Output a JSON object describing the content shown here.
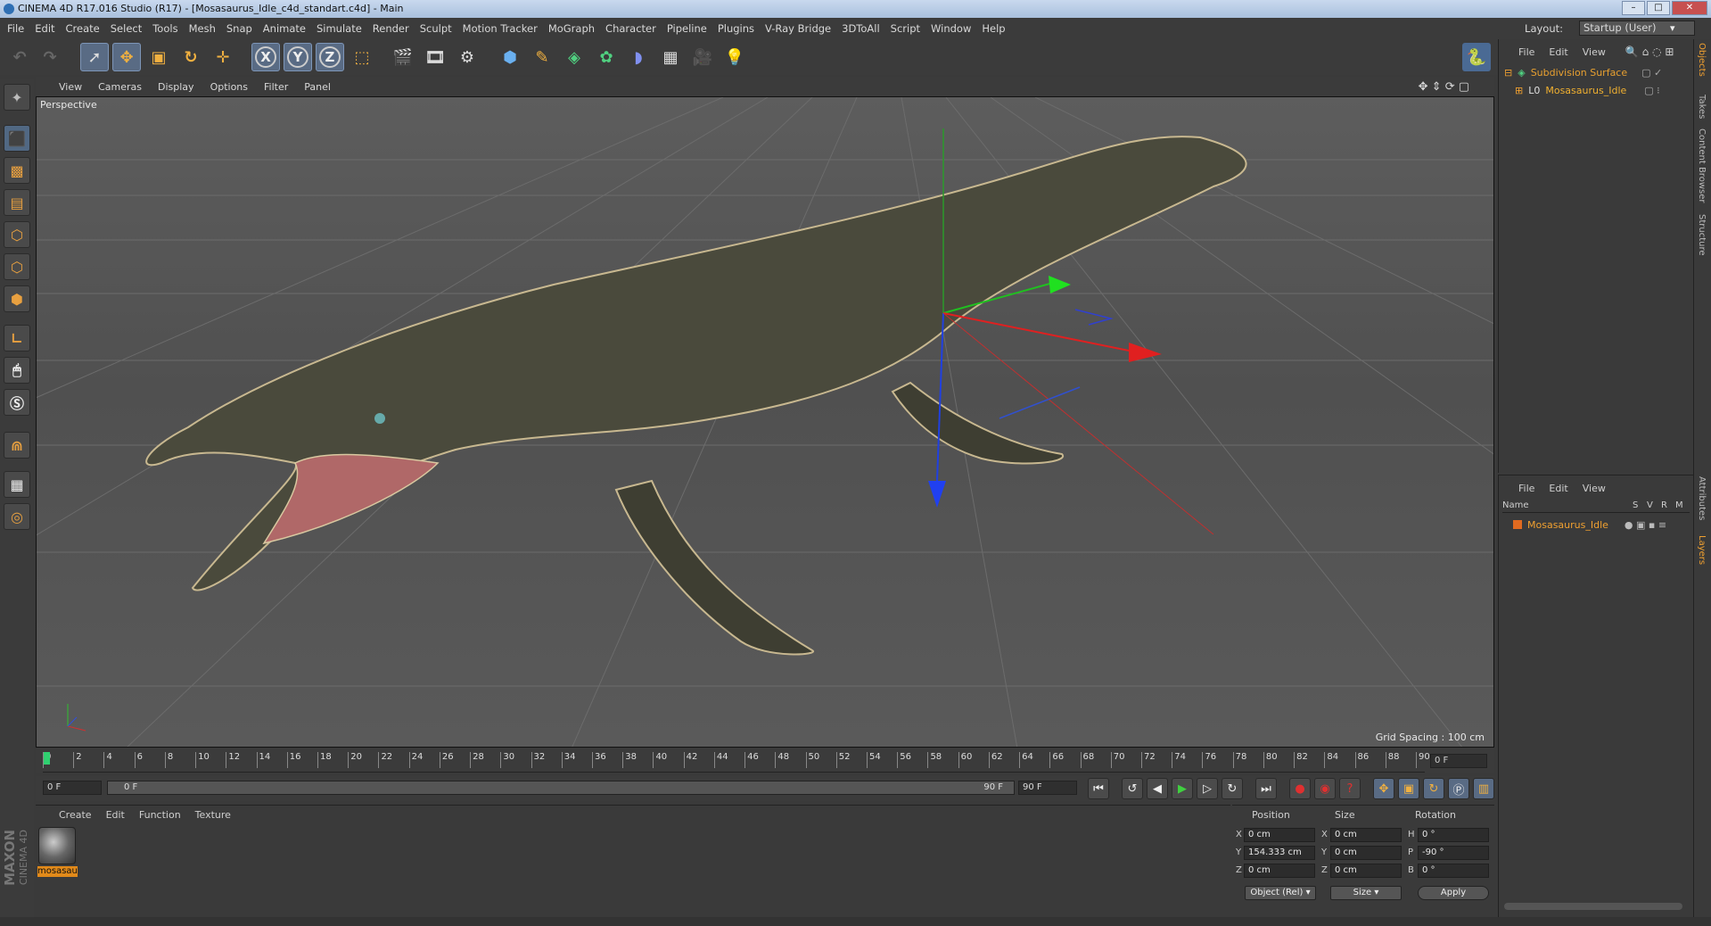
{
  "window": {
    "title": "CINEMA 4D R17.016 Studio (R17) - [Mosasaurus_Idle_c4d_standart.c4d] - Main"
  },
  "menubar": {
    "items": [
      "File",
      "Edit",
      "Create",
      "Select",
      "Tools",
      "Mesh",
      "Snap",
      "Animate",
      "Simulate",
      "Render",
      "Sculpt",
      "Motion Tracker",
      "MoGraph",
      "Character",
      "Pipeline",
      "Plugins",
      "V-Ray Bridge",
      "3DToAll",
      "Script",
      "Window",
      "Help"
    ],
    "layout_label": "Layout:",
    "layout_value": "Startup (User)"
  },
  "toolbar": {
    "axis_x": "X",
    "axis_y": "Y",
    "axis_z": "Z"
  },
  "viewport": {
    "menu": [
      "View",
      "Cameras",
      "Display",
      "Options",
      "Filter",
      "Panel"
    ],
    "label": "Perspective",
    "grid_spacing": "Grid Spacing : 100 cm"
  },
  "timeline": {
    "ticks": [
      "0",
      "2",
      "4",
      "6",
      "8",
      "10",
      "12",
      "14",
      "16",
      "18",
      "20",
      "22",
      "24",
      "26",
      "28",
      "30",
      "32",
      "34",
      "36",
      "38",
      "40",
      "42",
      "44",
      "46",
      "48",
      "50",
      "52",
      "54",
      "56",
      "58",
      "60",
      "62",
      "64",
      "66",
      "68",
      "70",
      "72",
      "74",
      "76",
      "78",
      "80",
      "82",
      "84",
      "86",
      "88",
      "90"
    ],
    "end_field": "0 F"
  },
  "transport": {
    "current": "0 F",
    "range_start": "0 F",
    "range_end": "90 F",
    "max": "90 F"
  },
  "material": {
    "menu": [
      "Create",
      "Edit",
      "Function",
      "Texture"
    ],
    "name": "mosasau"
  },
  "coordinates": {
    "headers": [
      "Position",
      "Size",
      "Rotation"
    ],
    "rows": [
      {
        "axis": "X",
        "pos": "0 cm",
        "size_axis": "X",
        "size": "0 cm",
        "rot_axis": "H",
        "rot": "0 °"
      },
      {
        "axis": "Y",
        "pos": "154.333 cm",
        "size_axis": "Y",
        "size": "0 cm",
        "rot_axis": "P",
        "rot": "-90 °"
      },
      {
        "axis": "Z",
        "pos": "0 cm",
        "size_axis": "Z",
        "size": "0 cm",
        "rot_axis": "B",
        "rot": "0 °"
      }
    ],
    "mode_dropdown": "Object (Rel)",
    "size_dropdown": "Size",
    "apply": "Apply"
  },
  "objects": {
    "menu": [
      "File",
      "Edit",
      "View"
    ],
    "items": [
      "Subdivision Surface",
      "Mosasaurus_Idle"
    ]
  },
  "layers": {
    "menu": [
      "File",
      "Edit",
      "View"
    ],
    "columns": [
      "Name",
      "S",
      "V",
      "R",
      "M"
    ],
    "items": [
      "Mosasaurus_Idle"
    ]
  },
  "sidetabs": [
    "Objects",
    "Takes",
    "Content Browser",
    "Structure",
    "Attributes",
    "Layers"
  ],
  "branding": {
    "line1": "MAXON",
    "line2": "CINEMA 4D"
  },
  "colors": {
    "accent": "#f0a030",
    "selected_tool": "#596b84",
    "x_axis": "#e02020",
    "y_axis": "#20c020",
    "z_axis": "#2040e0"
  }
}
